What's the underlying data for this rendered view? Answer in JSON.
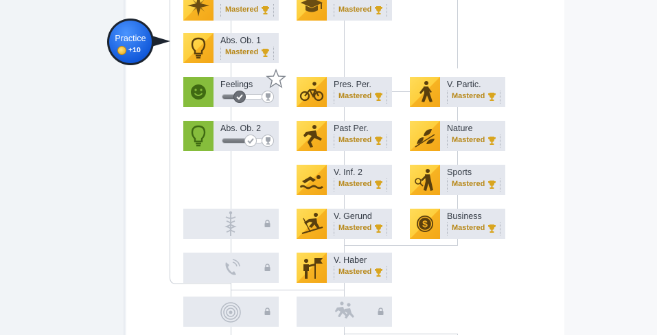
{
  "practice": {
    "label": "Practice",
    "coins": "+10"
  },
  "status": {
    "mastered": "Mastered"
  },
  "tiles": {
    "top_left": {
      "icon": "compass-rose-icon",
      "state": "mastered"
    },
    "top_middle": {
      "icon": "graduation-cap-icon",
      "state": "mastered"
    },
    "abs_ob_1": {
      "name": "Abs. Ob. 1",
      "icon": "lightbulb-icon",
      "state": "mastered"
    },
    "feelings": {
      "name": "Feelings",
      "icon": "smiley-face-icon",
      "state": "in-progress",
      "progress": 0.45
    },
    "abs_ob_2": {
      "name": "Abs. Ob. 2",
      "icon": "lightbulb-icon",
      "state": "in-progress",
      "progress": 0.72
    },
    "pres_per": {
      "name": "Pres. Per.",
      "icon": "cyclist-icon",
      "state": "mastered"
    },
    "v_partic": {
      "name": "V. Partic.",
      "icon": "hiker-icon",
      "state": "mastered"
    },
    "past_per": {
      "name": "Past Per.",
      "icon": "sprinter-icon",
      "state": "mastered"
    },
    "nature": {
      "name": "Nature",
      "icon": "leaves-icon",
      "state": "mastered"
    },
    "v_inf_2": {
      "name": "V. Inf. 2",
      "icon": "swimmer-icon",
      "state": "mastered"
    },
    "sports": {
      "name": "Sports",
      "icon": "tennis-player-icon",
      "state": "mastered"
    },
    "v_gerund": {
      "name": "V. Gerund",
      "icon": "skier-icon",
      "state": "mastered"
    },
    "business": {
      "name": "Business",
      "icon": "dollar-coin-icon",
      "state": "mastered"
    },
    "v_haber": {
      "name": "V. Haber",
      "icon": "flag-person-icon",
      "state": "mastered"
    },
    "locked_medical": {
      "icon": "caduceus-icon",
      "state": "locked"
    },
    "locked_phone": {
      "icon": "telephone-icon",
      "state": "locked"
    },
    "locked_signal": {
      "icon": "radio-signal-icon",
      "state": "locked"
    },
    "locked_runners": {
      "icon": "runners-icon",
      "state": "locked"
    }
  },
  "colors": {
    "gold_tile": "#fecf3d",
    "gold_tile_dark": "#f3a718",
    "green_tile": "#86bd3c",
    "mastered_text": "#b8891a",
    "practice_bubble": "#1e6ff0",
    "tile_background": "#e4e7ee"
  }
}
